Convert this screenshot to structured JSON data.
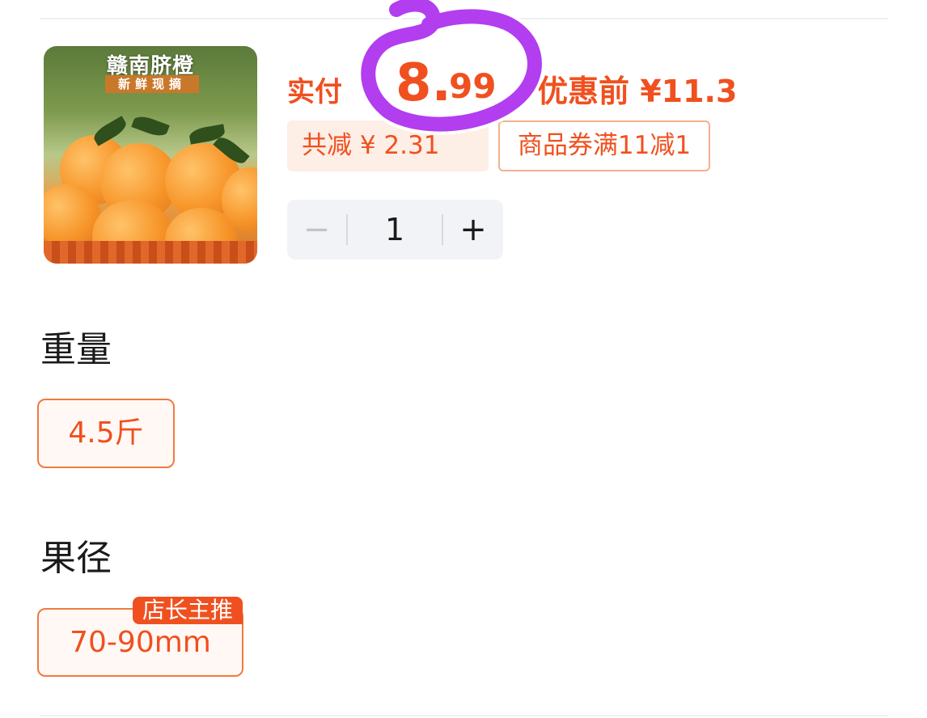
{
  "product": {
    "image_title": "赣南脐橙",
    "image_subtitle": "新鲜现摘",
    "price": {
      "prefix": "实付",
      "integer": "8.",
      "decimal": "99",
      "original": "优惠前 ¥11.3"
    },
    "discount_tag": "共减 ¥ 2.31",
    "coupon_tag": "商品券满11减1",
    "quantity": {
      "minus": "−",
      "value": "1",
      "plus": "+"
    }
  },
  "options": {
    "weight": {
      "title": "重量",
      "values": [
        "4.5斤"
      ]
    },
    "diameter": {
      "title": "果径",
      "values": [
        "70-90mm"
      ],
      "badge": "店长主推"
    }
  },
  "colors": {
    "accent": "#f0501f",
    "tag_bg": "#fdeee6",
    "annotation": "#b23ef0"
  }
}
